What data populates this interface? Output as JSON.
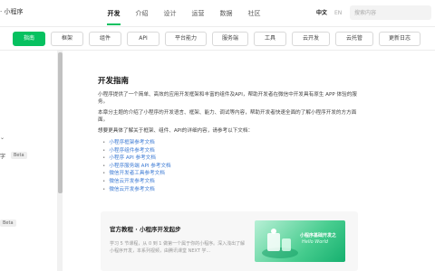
{
  "header": {
    "brand": "· 小程序",
    "nav": [
      "开发",
      "介绍",
      "设计",
      "运营",
      "数据",
      "社区"
    ],
    "lang_current": "中文",
    "lang_alt": "EN",
    "search_placeholder": "搜索内容"
  },
  "subnav": {
    "items": [
      "指南",
      "框架",
      "组件",
      "API",
      "平台能力",
      "服务端",
      "工具",
      "云开发",
      "云托管",
      "更新日志"
    ]
  },
  "sidebar": {
    "partial_label": "字",
    "beta_1": "Beta",
    "beta_2": "Beta"
  },
  "doc": {
    "title": "开发指南",
    "intro": "小程序提供了一个简单、高效的应用开发框架和丰富的组件及API，帮助开发者在微信中开发具有原生 APP 体验的服务。",
    "overview": "本章分主题的介绍了小程序的开发语言、框架、能力、调试等内容，帮助开发者快速全面的了解小程序开发的方方面面。",
    "docs_intro": "想要更具体了解关于框架、组件、API的详细内容，请参考以下文档：",
    "links": [
      "小程序框架参考文档",
      "小程序组件参考文档",
      "小程序 API 参考文档",
      "小程序服务端 API 参考文档",
      "微信开发者工具参考文档",
      "微信云开发参考文档",
      "微信云开发参考文档"
    ]
  },
  "card": {
    "title": "官方教程 · 小程序开发起步",
    "desc": "学习 5 节课程，从 0 到 1 做第一个属于你的小程序。深入浅出了解小程序开发，本系列视频，由腾讯课堂 NEXT 学...",
    "banner_title": "小程序基础开发之",
    "banner_sub": "Hello World"
  },
  "colors": {
    "accent": "#07c160",
    "link": "#3d7bd4"
  }
}
